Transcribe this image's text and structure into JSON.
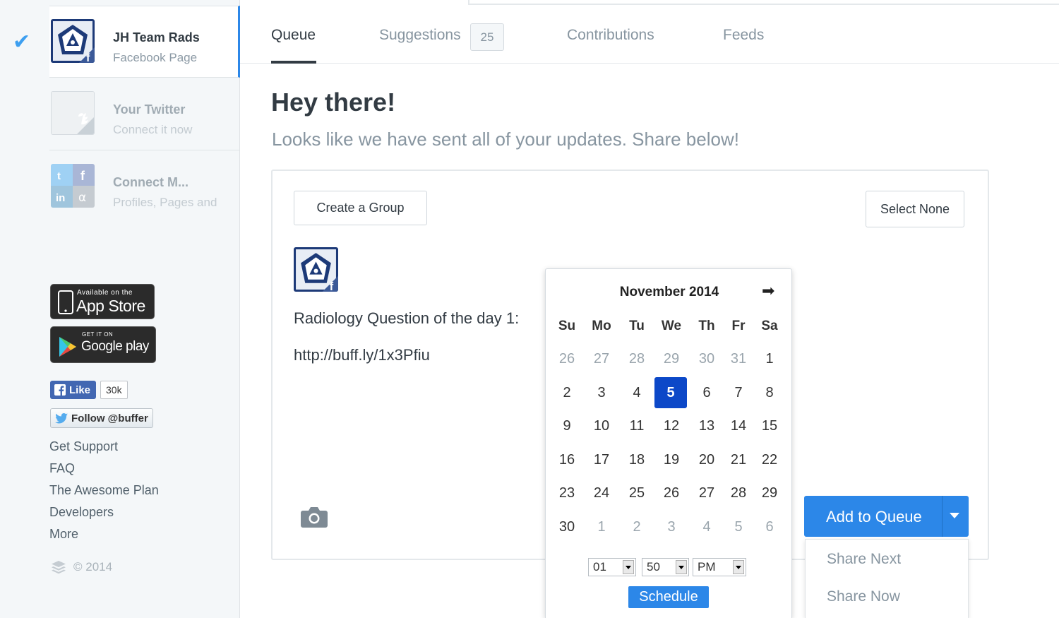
{
  "accounts": [
    {
      "name": "JH Team Rads",
      "subtitle": "Facebook Page",
      "selected": true
    },
    {
      "name": "Your Twitter",
      "subtitle": "Connect it now"
    },
    {
      "name": "Connect M...",
      "subtitle": "Profiles, Pages and"
    }
  ],
  "badges": {
    "appstore_small": "Available on the",
    "appstore_big": "App Store",
    "googleplay_small": "GET IT ON",
    "googleplay_big": "Google play"
  },
  "social": {
    "fb_like_label": "Like",
    "fb_like_count": "30k",
    "tw_follow_label": "Follow @buffer"
  },
  "side_links": [
    "Get Support",
    "FAQ",
    "The Awesome Plan",
    "Developers",
    "More"
  ],
  "copyright": "© 2014",
  "tabs": [
    {
      "label": "Queue",
      "active": true
    },
    {
      "label": "Suggestions",
      "count": "25"
    },
    {
      "label": "Contributions"
    },
    {
      "label": "Feeds"
    }
  ],
  "main": {
    "heading": "Hey there!",
    "subheading": "Looks like we have sent all of your updates. Share below!"
  },
  "composer": {
    "create_group": "Create a Group",
    "select_none": "Select None",
    "post_text": "Radiology Question of the day 1:",
    "post_link": "http://buff.ly/1x3Pfiu",
    "add_to_queue": "Add to Queue",
    "menu": [
      "Share Next",
      "Share Now"
    ]
  },
  "calendar": {
    "month_label": "November 2014",
    "weekdays": [
      "Su",
      "Mo",
      "Tu",
      "We",
      "Th",
      "Fr",
      "Sa"
    ],
    "weeks": [
      [
        "26",
        "27",
        "28",
        "29",
        "30",
        "31",
        "1"
      ],
      [
        "2",
        "3",
        "4",
        "5",
        "6",
        "7",
        "8"
      ],
      [
        "9",
        "10",
        "11",
        "12",
        "13",
        "14",
        "15"
      ],
      [
        "16",
        "17",
        "18",
        "19",
        "20",
        "21",
        "22"
      ],
      [
        "23",
        "24",
        "25",
        "26",
        "27",
        "28",
        "29"
      ],
      [
        "30",
        "1",
        "2",
        "3",
        "4",
        "5",
        "6"
      ]
    ],
    "selected_day": "5",
    "hour": "01",
    "minute": "50",
    "ampm": "PM",
    "schedule_label": "Schedule"
  },
  "colors": {
    "accent": "#2c87e8",
    "selected_day": "#0c48c8",
    "facebook": "#4267b2",
    "twitter": "#55acee"
  }
}
